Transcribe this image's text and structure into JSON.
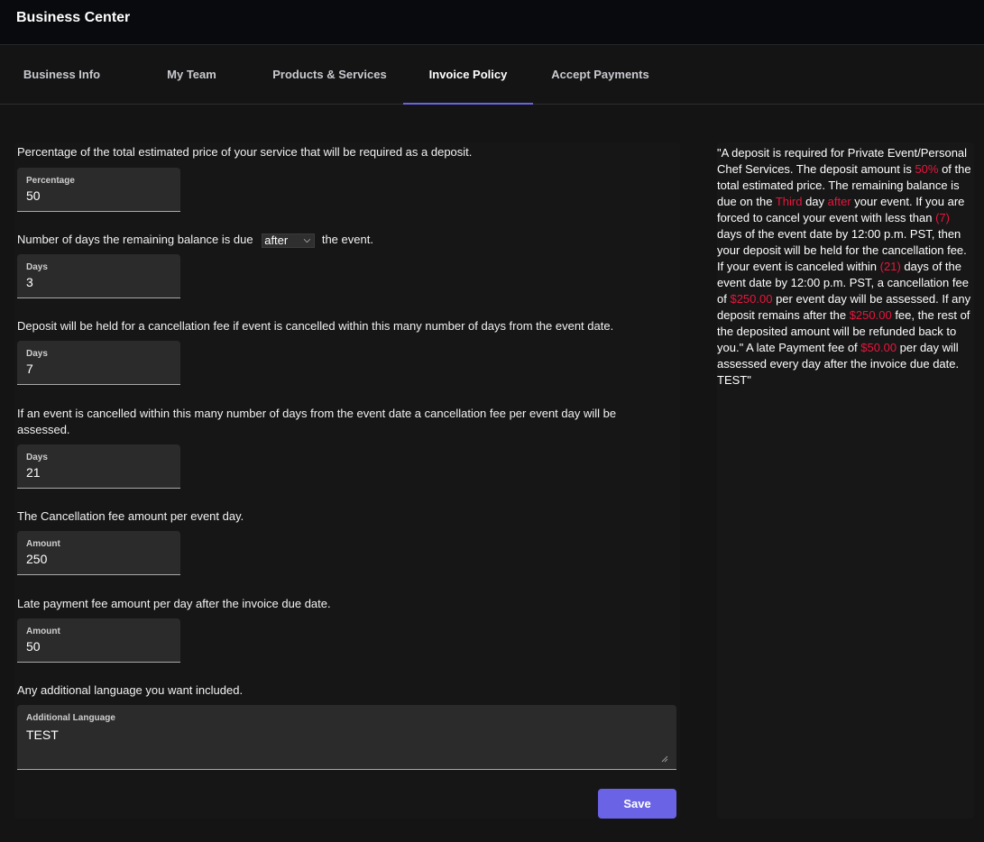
{
  "app": {
    "title": "Business Center"
  },
  "tabs": [
    {
      "label": "Business Info",
      "active": false
    },
    {
      "label": "My Team",
      "active": false
    },
    {
      "label": "Products & Services",
      "active": false
    },
    {
      "label": "Invoice Policy",
      "active": true
    },
    {
      "label": "Accept Payments",
      "active": false
    }
  ],
  "form": {
    "deposit": {
      "question": "Percentage of the total estimated price of your service that will be required as a deposit.",
      "label": "Percentage",
      "value": "50"
    },
    "balance": {
      "question_before": "Number of days the remaining balance is due",
      "select_value": "after",
      "question_after": "the event.",
      "label": "Days",
      "value": "3"
    },
    "deposit_held": {
      "question": "Deposit will be held for a cancellation fee if event is cancelled within this many number of days from the event date.",
      "label": "Days",
      "value": "7"
    },
    "cancel_window": {
      "question": "If an event is cancelled within this many number of days from the event date a cancellation fee per event day will be assessed.",
      "label": "Days",
      "value": "21"
    },
    "cancel_fee": {
      "question": "The Cancellation fee amount per event day.",
      "label": "Amount",
      "value": "250"
    },
    "late_fee": {
      "question": "Late payment fee amount per day after the invoice due date.",
      "label": "Amount",
      "value": "50"
    },
    "additional": {
      "question": "Any additional language you want included.",
      "label": "Additional Language",
      "value": "TEST"
    },
    "save_label": "Save"
  },
  "preview": {
    "p1": "\"A deposit is required for Private Event/Personal Chef Services. The deposit amount is ",
    "h1": "50%",
    "p2": " of the total estimated price. The remaining balance is due on the ",
    "h2": "Third",
    "p3": " day ",
    "h3": "after",
    "p4": " your event. If you are forced to cancel your event with less than ",
    "h4": "(7)",
    "p5": " days of the event date by 12:00 p.m. PST, then your deposit will be held for the cancellation fee. If your event is canceled within ",
    "h5": "(21)",
    "p6": " days of the event date by 12:00 p.m. PST, a cancellation fee of ",
    "h6": "$250.00",
    "p7": " per event day will be assessed. If any deposit remains after the ",
    "h7": "$250.00",
    "p8": " fee, the rest of the deposited amount will be refunded back to you.\" A late Payment fee of ",
    "h8": "$50.00",
    "p9": " per day will assessed every day after the invoice due date. TEST\""
  },
  "colors": {
    "accent": "#6b63e6",
    "highlight": "#e8163c",
    "background": "#141414"
  }
}
